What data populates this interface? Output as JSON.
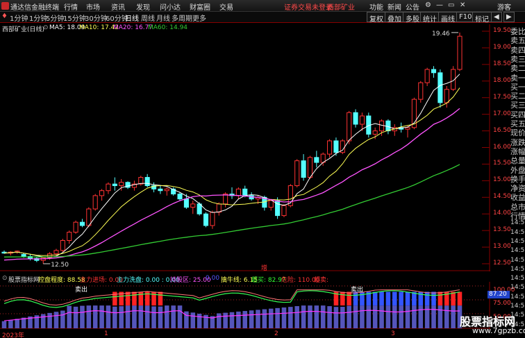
{
  "app": {
    "title": "通达信金融终端"
  },
  "menu": [
    "行情",
    "市场",
    "资讯",
    "发现",
    "问小达",
    "财富圈",
    "交易"
  ],
  "notice": {
    "login": "证券交易未登录",
    "stock": "西部矿业"
  },
  "top_buttons": [
    "功能",
    "新闻",
    "公告",
    "游客"
  ],
  "periods": [
    "1分钟",
    "1分钟",
    "5分钟",
    "15分钟",
    "30分钟",
    "60分钟",
    "日线",
    "周线",
    "月线",
    "多周期",
    "更多"
  ],
  "period_active_index": 6,
  "right_tools": [
    "复权",
    "叠加",
    "多股",
    "统计",
    "画线",
    "F10",
    "标记",
    "◀",
    "▶"
  ],
  "chart_info": {
    "title": "西部矿业(日线)",
    "ma5": "MA5: 18.09",
    "ma10": "MA10: 17.42",
    "ma20": "MA20: 16.77",
    "ma60": "MA60: 14.94",
    "high_label": "19.46",
    "low_label": "12.50",
    "mid_label": "增"
  },
  "y_labels": [
    "19.50",
    "19.00",
    "18.50",
    "18.00",
    "17.50",
    "17.00",
    "16.50",
    "16.00",
    "15.50",
    "15.00",
    "14.50",
    "14.00",
    "13.50",
    "13.00",
    "12.50"
  ],
  "indicator": {
    "name": "股票指标网",
    "kongpan": "控盘程度: 88.58",
    "zhuli_in": "主力进场: 0.00",
    "zhuli_wash": "主力洗盘: 0.00 : 0.00",
    "chicang": "持股区: 25.00",
    "chicang_val": "0.00",
    "qinxian": "擒牛线: 6.15",
    "chaomai": "超买: 82.97",
    "fengxian": "危险: 110.00",
    "chaomai2": "超卖:",
    "sell1": "卖出",
    "sell2": "卖出",
    "current_val": "87.20"
  },
  "ind_y_labels": [
    "100.00",
    "75.00",
    "50.00"
  ],
  "sidebar_items": [
    "委比",
    "卖五",
    "卖四",
    "卖三",
    "卖二",
    "卖一",
    "买一",
    "买二",
    "买三",
    "买四",
    "买五",
    "现价",
    "涨跌",
    "涨幅",
    "总量",
    "外盘",
    "换手",
    "净资",
    "收益",
    "总市",
    "行情",
    "14:50",
    "14:50",
    "14:50",
    "14:51",
    "14:51",
    "14:51",
    "14:51",
    "14:51",
    "14:51",
    "14:51",
    "14:51",
    "14:51"
  ],
  "time_labels": [
    "2023年",
    "1",
    "2",
    "3"
  ],
  "watermark": {
    "main": "股票指标网",
    "url": "www.7gpzb.com"
  },
  "colors": {
    "up": "#ff3333",
    "down": "#55ffff",
    "ma5": "#ffffff",
    "ma10": "#ffff55",
    "ma20": "#ff55ff",
    "ma60": "#33cc33",
    "bg": "#000000"
  },
  "chart_data": {
    "type": "candlestick",
    "title": "西部矿业(日线)",
    "ylim": [
      12.4,
      19.7
    ],
    "ohlc": [
      [
        12.85,
        12.9,
        12.8,
        12.82
      ],
      [
        12.82,
        12.88,
        12.75,
        12.85
      ],
      [
        12.85,
        12.9,
        12.8,
        12.88
      ],
      [
        12.78,
        12.82,
        12.68,
        12.72
      ],
      [
        12.72,
        12.78,
        12.6,
        12.66
      ],
      [
        12.66,
        12.72,
        12.55,
        12.6
      ],
      [
        12.6,
        12.72,
        12.5,
        12.68
      ],
      [
        12.68,
        12.85,
        12.62,
        12.8
      ],
      [
        12.8,
        12.95,
        12.75,
        12.9
      ],
      [
        12.9,
        13.25,
        12.85,
        13.2
      ],
      [
        13.2,
        13.5,
        13.1,
        13.45
      ],
      [
        13.45,
        13.8,
        13.4,
        13.75
      ],
      [
        13.75,
        13.85,
        13.6,
        13.65
      ],
      [
        13.65,
        14.2,
        13.6,
        14.15
      ],
      [
        14.15,
        14.6,
        14.1,
        14.55
      ],
      [
        14.55,
        14.75,
        14.4,
        14.7
      ],
      [
        14.7,
        14.95,
        14.6,
        14.9
      ],
      [
        14.9,
        15.1,
        14.7,
        14.85
      ],
      [
        14.85,
        15.05,
        14.7,
        14.95
      ],
      [
        14.95,
        14.98,
        14.75,
        14.8
      ],
      [
        14.8,
        15.0,
        14.7,
        14.9
      ],
      [
        14.9,
        15.15,
        14.85,
        15.1
      ],
      [
        15.1,
        15.2,
        14.8,
        14.85
      ],
      [
        14.85,
        14.95,
        14.65,
        14.75
      ],
      [
        14.75,
        14.85,
        14.6,
        14.7
      ],
      [
        14.7,
        14.8,
        14.55,
        14.75
      ],
      [
        14.75,
        14.8,
        14.55,
        14.6
      ],
      [
        14.6,
        14.65,
        14.4,
        14.45
      ],
      [
        14.45,
        14.6,
        14.15,
        14.2
      ],
      [
        14.2,
        14.4,
        14.0,
        14.3
      ],
      [
        14.3,
        14.35,
        13.95,
        14.0
      ],
      [
        14.0,
        14.05,
        13.6,
        13.65
      ],
      [
        13.65,
        14.1,
        13.55,
        14.05
      ],
      [
        14.05,
        14.35,
        13.95,
        14.3
      ],
      [
        14.3,
        14.65,
        14.2,
        14.6
      ],
      [
        14.6,
        14.8,
        14.45,
        14.55
      ],
      [
        14.55,
        14.8,
        14.45,
        14.75
      ],
      [
        14.75,
        14.85,
        14.5,
        14.55
      ],
      [
        14.55,
        14.65,
        14.4,
        14.45
      ],
      [
        14.45,
        14.55,
        14.3,
        14.5
      ],
      [
        14.5,
        14.55,
        14.1,
        14.2
      ],
      [
        14.2,
        14.45,
        14.1,
        14.4
      ],
      [
        14.4,
        14.5,
        13.85,
        13.95
      ],
      [
        13.95,
        14.3,
        13.9,
        14.25
      ],
      [
        14.25,
        14.9,
        14.2,
        14.85
      ],
      [
        14.85,
        15.65,
        14.8,
        15.6
      ],
      [
        15.6,
        15.8,
        15.0,
        15.1
      ],
      [
        15.1,
        15.75,
        15.05,
        15.7
      ],
      [
        15.7,
        15.9,
        15.4,
        15.55
      ],
      [
        15.55,
        15.85,
        15.45,
        15.8
      ],
      [
        15.8,
        16.25,
        15.7,
        16.2
      ],
      [
        16.2,
        16.3,
        15.75,
        15.85
      ],
      [
        15.85,
        16.25,
        15.8,
        16.2
      ],
      [
        16.2,
        17.1,
        16.1,
        17.05
      ],
      [
        17.05,
        17.15,
        16.6,
        16.7
      ],
      [
        16.7,
        17.05,
        16.5,
        16.95
      ],
      [
        16.95,
        17.05,
        16.3,
        16.4
      ],
      [
        16.4,
        16.6,
        16.25,
        16.5
      ],
      [
        16.5,
        16.85,
        16.35,
        16.8
      ],
      [
        16.8,
        16.85,
        16.4,
        16.5
      ],
      [
        16.5,
        16.7,
        16.35,
        16.6
      ],
      [
        16.6,
        16.75,
        16.45,
        16.55
      ],
      [
        16.55,
        16.65,
        16.3,
        16.6
      ],
      [
        16.6,
        17.5,
        16.55,
        17.45
      ],
      [
        17.45,
        18.0,
        17.35,
        17.95
      ],
      [
        17.95,
        18.4,
        17.85,
        18.35
      ],
      [
        18.35,
        18.45,
        18.1,
        18.25
      ],
      [
        18.25,
        18.35,
        17.2,
        17.35
      ],
      [
        17.35,
        17.85,
        17.2,
        17.75
      ],
      [
        17.75,
        18.45,
        17.7,
        18.35
      ],
      [
        18.35,
        19.46,
        18.3,
        19.35
      ]
    ],
    "ma_values": {
      "MA5": 18.09,
      "MA10": 17.42,
      "MA20": 16.77,
      "MA60": 14.94
    }
  }
}
